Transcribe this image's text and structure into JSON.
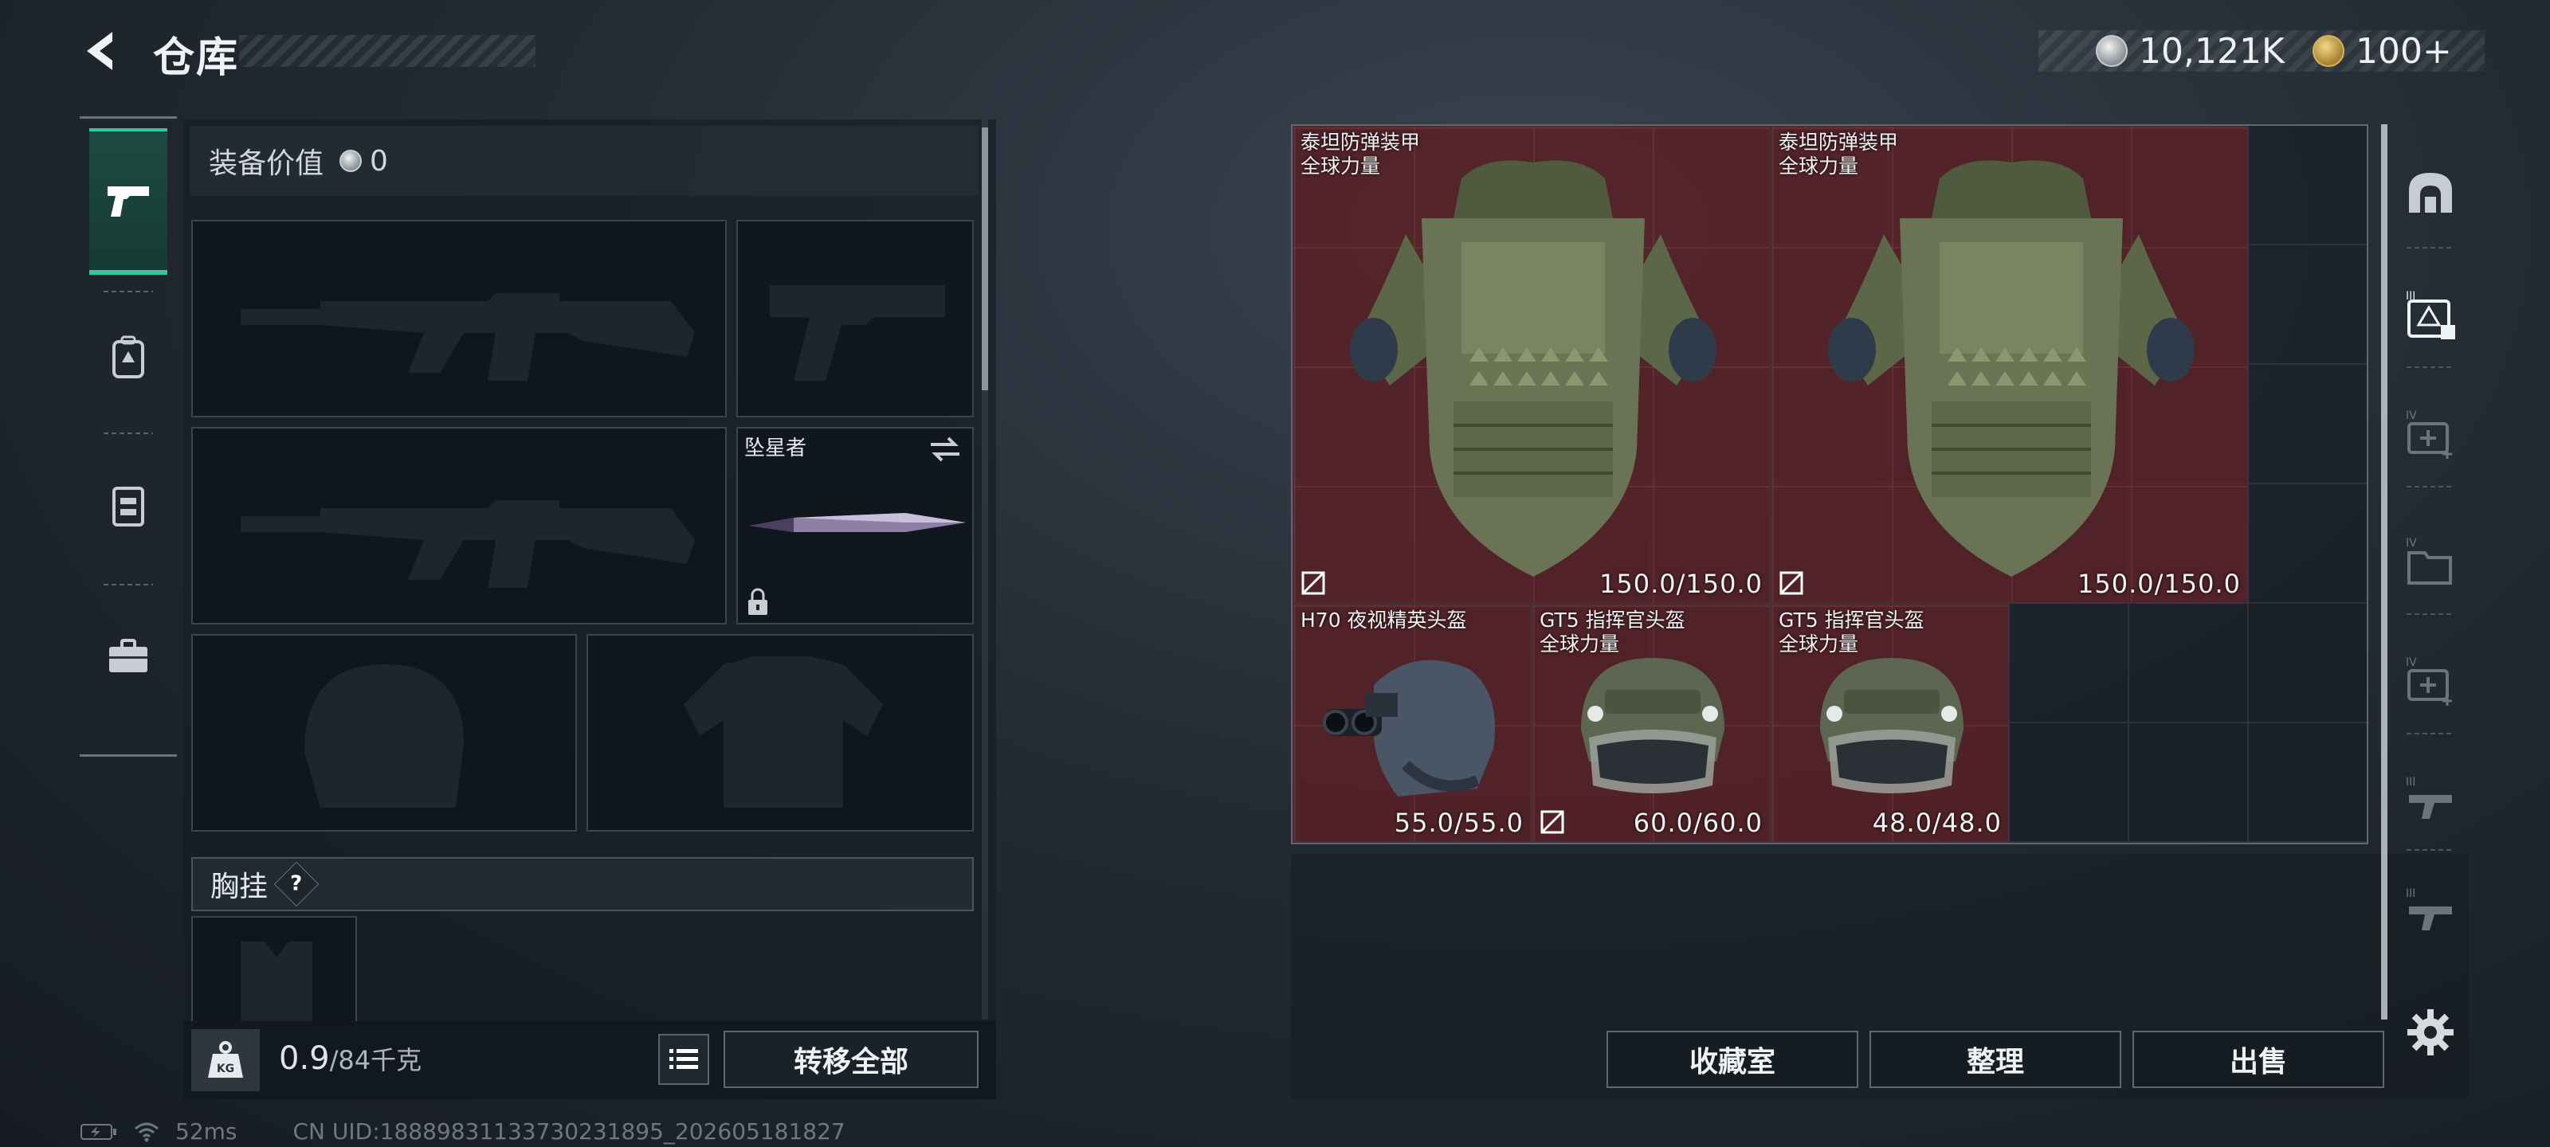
{
  "header": {
    "title": "仓库",
    "currencies": [
      {
        "icon": "silver-coin-icon",
        "value": "10,121K"
      },
      {
        "icon": "gold-coin-icon",
        "value": "100+"
      }
    ]
  },
  "categories": [
    {
      "icon": "pistol-icon",
      "active": true
    },
    {
      "icon": "backpack-icon",
      "active": false
    },
    {
      "icon": "chest-rig-icon",
      "active": false
    },
    {
      "icon": "case-icon",
      "active": false
    }
  ],
  "equipment": {
    "value_label": "装备价值",
    "value": "0",
    "melee_slot_label": "坠星者",
    "chest_section_label": "胸挂",
    "help_glyph": "?",
    "weight_current": "0.9",
    "weight_max": "/84千克",
    "transfer_all_label": "转移全部"
  },
  "warehouse_items": [
    {
      "name_line1": "泰坦防弹装甲",
      "name_line2": "全球力量",
      "durability": "150.0/150.0",
      "kind": "armor"
    },
    {
      "name_line1": "泰坦防弹装甲",
      "name_line2": "全球力量",
      "durability": "150.0/150.0",
      "kind": "armor"
    },
    {
      "name_line1": "H70 夜视精英头盔",
      "name_line2": "",
      "durability": "55.0/55.0",
      "kind": "nv-helmet"
    },
    {
      "name_line1": "GT5 指挥官头盔",
      "name_line2": "全球力量",
      "durability": "60.0/60.0",
      "kind": "helmet"
    },
    {
      "name_line1": "GT5 指挥官头盔",
      "name_line2": "全球力量",
      "durability": "48.0/48.0",
      "kind": "helmet"
    }
  ],
  "actions": {
    "collection_label": "收藏室",
    "organize_label": "整理",
    "sell_label": "出售"
  },
  "status": {
    "ping": "52ms",
    "uid": "CN UID:1888983113373023189​5_202605181827"
  }
}
